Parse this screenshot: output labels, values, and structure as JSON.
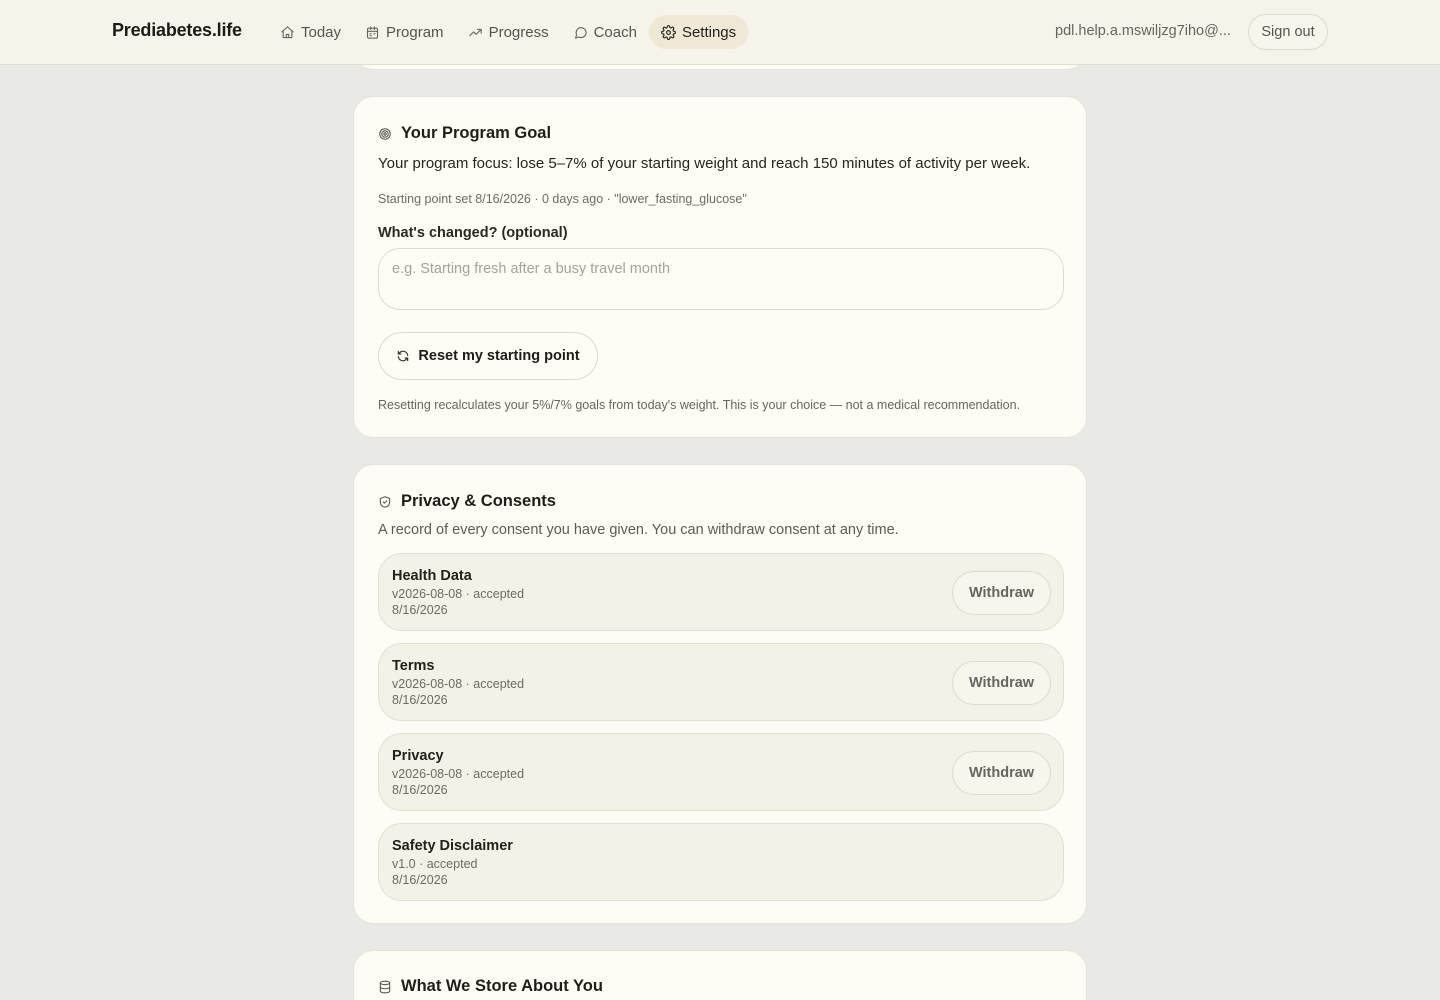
{
  "header": {
    "brand": "Prediabetes.life",
    "nav": [
      {
        "label": "Today",
        "icon": "home-icon"
      },
      {
        "label": "Program",
        "icon": "calendar-icon"
      },
      {
        "label": "Progress",
        "icon": "trending-up-icon"
      },
      {
        "label": "Coach",
        "icon": "chat-bubble-icon"
      },
      {
        "label": "Settings",
        "icon": "gear-icon",
        "active": true
      }
    ],
    "user_email": "pdl.help.a.mswiljzg7iho@...",
    "sign_out_label": "Sign out"
  },
  "program_goal": {
    "title": "Your Program Goal",
    "focus": "Your program focus: lose 5–7% of your starting weight and reach 150 minutes of activity per week.",
    "meta": "Starting point set 8/16/2026 · 0 days ago · \"lower_fasting_glucose\"",
    "changed_label": "What's changed? (optional)",
    "changed_value": "",
    "changed_placeholder": "e.g. Starting fresh after a busy travel month",
    "reset_label": "Reset my starting point",
    "reset_note": "Resetting recalculates your 5%/7% goals from today's weight. This is your choice — not a medical recommendation."
  },
  "privacy": {
    "title": "Privacy & Consents",
    "description": "A record of every consent you have given. You can withdraw consent at any time.",
    "withdraw_label": "Withdraw",
    "consents": [
      {
        "name": "Health Data",
        "version": "v2026-08-08 · accepted",
        "date": "8/16/2026",
        "withdrawable": true
      },
      {
        "name": "Terms",
        "version": "v2026-08-08 · accepted",
        "date": "8/16/2026",
        "withdrawable": true
      },
      {
        "name": "Privacy",
        "version": "v2026-08-08 · accepted",
        "date": "8/16/2026",
        "withdrawable": true
      },
      {
        "name": "Safety Disclaimer",
        "version": "v1.0 · accepted",
        "date": "8/16/2026",
        "withdrawable": false
      }
    ]
  },
  "store": {
    "title": "What We Store About You"
  }
}
